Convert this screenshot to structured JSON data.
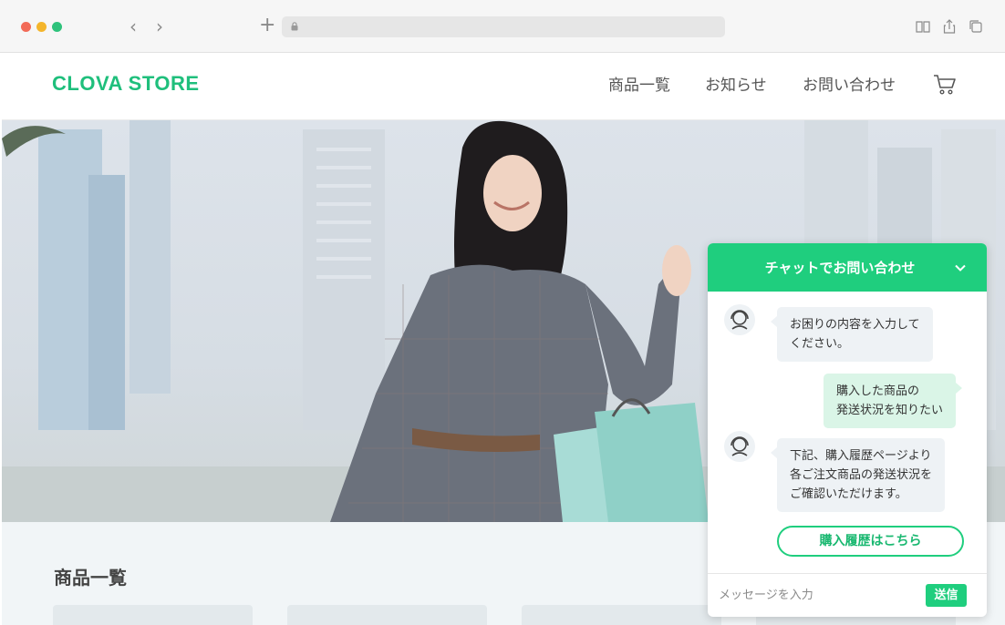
{
  "browser": {
    "back_icon": "‹",
    "forward_icon": "›",
    "new_tab_icon": "+",
    "icons": [
      "lock-icon",
      "reader-icon",
      "share-icon",
      "tabs-icon"
    ]
  },
  "site": {
    "brand": "CLOVA STORE",
    "nav": {
      "products": "商品一覧",
      "news": "お知らせ",
      "contact": "お問い合わせ"
    },
    "cart_icon": "cart-icon",
    "brand_color": "#1fbf7c"
  },
  "products": {
    "title": "商品一覧"
  },
  "chat": {
    "title": "チャットでお問い合わせ",
    "accent_color": "#1fce7e",
    "messages": [
      {
        "from": "bot",
        "text": "お困りの内容を入力して\nください。"
      },
      {
        "from": "user",
        "text": "購入した商品の\n発送状況を知りたい"
      },
      {
        "from": "bot",
        "text": "下記、購入履歴ページより\n各ご注文商品の発送状況を\nご確認いただけます。"
      }
    ],
    "history_button": "購入履歴はこちら",
    "input_placeholder": "メッセージを入力",
    "send_label": "送信"
  }
}
